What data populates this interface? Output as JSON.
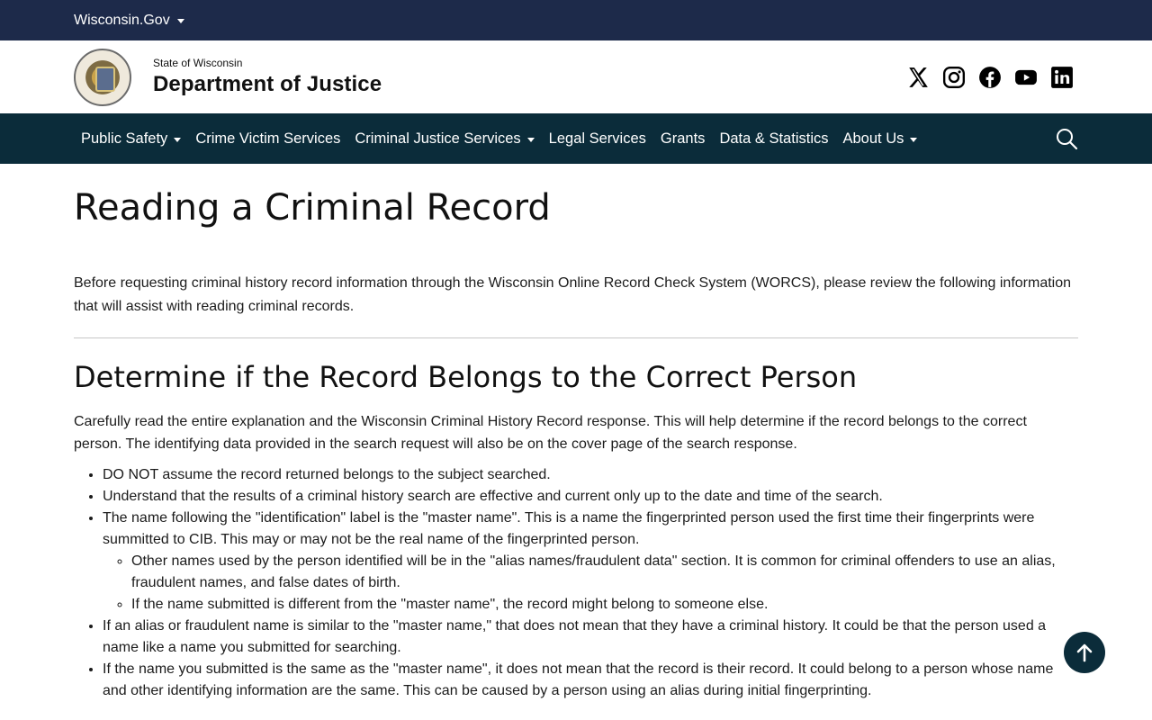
{
  "topbar": {
    "gov_label": "Wisconsin.Gov"
  },
  "header": {
    "state_label": "State of Wisconsin",
    "dept_label": "Department of Justice",
    "socials": [
      "x-icon",
      "instagram-icon",
      "facebook-icon",
      "youtube-icon",
      "linkedin-icon"
    ]
  },
  "nav": {
    "items": [
      {
        "label": "Public Safety",
        "dropdown": true
      },
      {
        "label": "Crime Victim Services",
        "dropdown": false
      },
      {
        "label": "Criminal Justice Services",
        "dropdown": true
      },
      {
        "label": "Legal Services",
        "dropdown": false
      },
      {
        "label": "Grants",
        "dropdown": false
      },
      {
        "label": "Data & Statistics",
        "dropdown": false
      },
      {
        "label": "About Us",
        "dropdown": true
      }
    ]
  },
  "page": {
    "title": "Reading a Criminal Record",
    "intro": "Before requesting criminal history record information through the Wisconsin Online Record Check System (WORCS), please review the following information that will assist with reading criminal records.",
    "section_title": "Determine if the Record Belongs to the Correct Person",
    "section_para": "Carefully read the entire explanation and the Wisconsin Criminal History Record response. This will help determine if the record belongs to the correct person. The identifying data provided in the search request will also be on the cover page of the search response.",
    "bullets": [
      "DO NOT assume the record returned belongs to the subject searched.",
      "Understand that the results of a criminal history search are effective and current only up to the date and time of the search.",
      "The name following the \"identification\" label is the \"master name\". This is a name the fingerprinted person used the first time their fingerprints were summitted to CIB. This may or may not be the real name of the fingerprinted person.",
      "If an alias or fraudulent name is similar to the \"master name,\" that does not mean that they have a criminal history. It could be that the person used a name like a name you submitted for searching.",
      "If the name you submitted is the same as the \"master name\", it does not mean that the record is their record. It could belong to a person whose name and other identifying information are the same. This can be caused by a person using an alias during initial fingerprinting."
    ],
    "sub_bullets": [
      "Other names used by the person identified will be in the \"alias names/fraudulent data\" section. It is common for criminal offenders to use an alias, fraudulent names, and false dates of birth.",
      "If the name submitted is different from the \"master name\", the record might belong to someone else."
    ]
  },
  "colors": {
    "topbar": "#1d2a4a",
    "nav": "#0b2c3a",
    "to_top": "#0b2c3a"
  }
}
